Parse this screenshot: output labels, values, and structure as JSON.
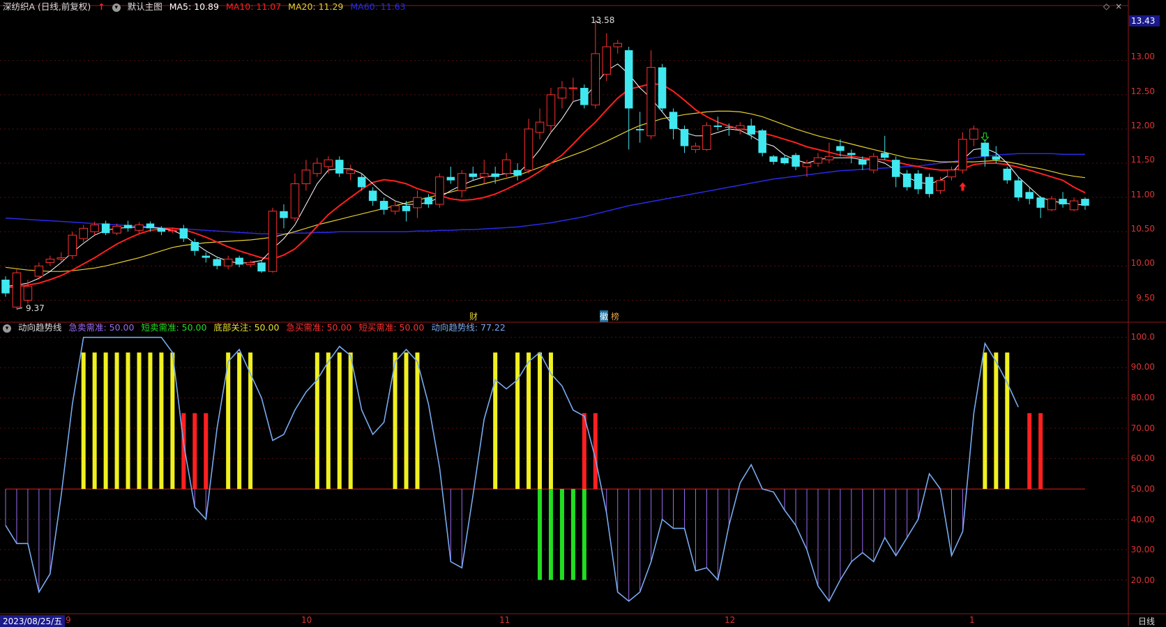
{
  "header_top": {
    "title": "深纺织A (日线,前复权)",
    "main_chart_label": "默认主图",
    "ma5": "MA5: 10.89",
    "ma10": "MA10: 11.07",
    "ma20": "MA20: 11.29",
    "ma60": "MA60: 11.63",
    "colors": {
      "ma5": "#ffffff",
      "ma10": "#ff2020",
      "ma20": "#e8d030",
      "ma60": "#2a2ae8"
    }
  },
  "header_bottom": {
    "indicator": "动向趋势线",
    "items": [
      {
        "text": "急卖需准: 50.00",
        "color": "#9b6cf0"
      },
      {
        "text": "短卖需准: 50.00",
        "color": "#22dd22"
      },
      {
        "text": "底部关注: 50.00",
        "color": "#e8e030"
      },
      {
        "text": "急买需准: 50.00",
        "color": "#ff3030"
      },
      {
        "text": "短买需准: 50.00",
        "color": "#ff3030"
      },
      {
        "text": "动向趋势线: 77.22",
        "color": "#78aaf0"
      }
    ]
  },
  "price_axis": {
    "current_price": "13.43",
    "ticks": [
      "13.00",
      "12.50",
      "12.00",
      "11.50",
      "11.00",
      "10.50",
      "10.00",
      "9.50"
    ]
  },
  "indicator_axis": {
    "ticks": [
      "100.0",
      "90.00",
      "80.00",
      "70.00",
      "60.00",
      "50.00",
      "40.00",
      "30.00",
      "20.00"
    ]
  },
  "annotations": {
    "high": "13.58",
    "low": "9.37",
    "marker_cai": "财",
    "marker_hui": "徽",
    "marker_bang": "榜"
  },
  "date_axis": {
    "cursor_date": "2023/08/25/五",
    "labels": [
      "9",
      "10",
      "11",
      "12",
      "1"
    ],
    "period": "日线"
  },
  "chart_data": {
    "type": "candlestick",
    "candles": [
      {
        "o": 9.8,
        "c": 9.6,
        "h": 9.85,
        "l": 9.55
      },
      {
        "o": 9.4,
        "c": 9.9,
        "h": 9.95,
        "l": 9.37
      },
      {
        "o": 9.5,
        "c": 9.7,
        "h": 9.8,
        "l": 9.45
      },
      {
        "o": 9.85,
        "c": 10.0,
        "h": 10.05,
        "l": 9.8
      },
      {
        "o": 10.05,
        "c": 10.1,
        "h": 10.15,
        "l": 10.0
      },
      {
        "o": 10.1,
        "c": 10.12,
        "h": 10.2,
        "l": 10.05
      },
      {
        "o": 10.15,
        "c": 10.45,
        "h": 10.5,
        "l": 10.1
      },
      {
        "o": 10.4,
        "c": 10.55,
        "h": 10.6,
        "l": 10.35
      },
      {
        "o": 10.5,
        "c": 10.6,
        "h": 10.65,
        "l": 10.45
      },
      {
        "o": 10.62,
        "c": 10.48,
        "h": 10.66,
        "l": 10.45
      },
      {
        "o": 10.48,
        "c": 10.58,
        "h": 10.62,
        "l": 10.45
      },
      {
        "o": 10.6,
        "c": 10.55,
        "h": 10.66,
        "l": 10.5
      },
      {
        "o": 10.52,
        "c": 10.6,
        "h": 10.64,
        "l": 10.48
      },
      {
        "o": 10.62,
        "c": 10.55,
        "h": 10.65,
        "l": 10.5
      },
      {
        "o": 10.55,
        "c": 10.5,
        "h": 10.58,
        "l": 10.45
      },
      {
        "o": 10.52,
        "c": 10.52,
        "h": 10.56,
        "l": 10.48
      },
      {
        "o": 10.55,
        "c": 10.4,
        "h": 10.6,
        "l": 10.35
      },
      {
        "o": 10.35,
        "c": 10.22,
        "h": 10.4,
        "l": 10.15
      },
      {
        "o": 10.15,
        "c": 10.12,
        "h": 10.2,
        "l": 10.05
      },
      {
        "o": 10.1,
        "c": 10.0,
        "h": 10.12,
        "l": 9.95
      },
      {
        "o": 10.0,
        "c": 10.1,
        "h": 10.15,
        "l": 9.95
      },
      {
        "o": 10.12,
        "c": 10.02,
        "h": 10.15,
        "l": 9.98
      },
      {
        "o": 10.02,
        "c": 10.05,
        "h": 10.08,
        "l": 9.98
      },
      {
        "o": 10.05,
        "c": 9.92,
        "h": 10.08,
        "l": 9.9
      },
      {
        "o": 9.92,
        "c": 10.8,
        "h": 10.85,
        "l": 9.9
      },
      {
        "o": 10.8,
        "c": 10.7,
        "h": 10.9,
        "l": 10.55
      },
      {
        "o": 10.7,
        "c": 11.2,
        "h": 11.35,
        "l": 10.65
      },
      {
        "o": 11.2,
        "c": 11.4,
        "h": 11.55,
        "l": 11.1
      },
      {
        "o": 11.35,
        "c": 11.5,
        "h": 11.58,
        "l": 11.3
      },
      {
        "o": 11.45,
        "c": 11.55,
        "h": 11.6,
        "l": 11.35
      },
      {
        "o": 11.55,
        "c": 11.35,
        "h": 11.6,
        "l": 11.3
      },
      {
        "o": 11.35,
        "c": 11.4,
        "h": 11.48,
        "l": 11.25
      },
      {
        "o": 11.3,
        "c": 11.15,
        "h": 11.35,
        "l": 11.1
      },
      {
        "o": 11.1,
        "c": 10.95,
        "h": 11.15,
        "l": 10.88
      },
      {
        "o": 10.95,
        "c": 10.82,
        "h": 11.0,
        "l": 10.75
      },
      {
        "o": 10.8,
        "c": 10.88,
        "h": 10.95,
        "l": 10.75
      },
      {
        "o": 10.88,
        "c": 10.8,
        "h": 10.95,
        "l": 10.65
      },
      {
        "o": 10.85,
        "c": 11.0,
        "h": 11.1,
        "l": 10.7
      },
      {
        "o": 11.0,
        "c": 10.9,
        "h": 11.05,
        "l": 10.85
      },
      {
        "o": 10.9,
        "c": 11.3,
        "h": 11.35,
        "l": 10.85
      },
      {
        "o": 11.3,
        "c": 11.25,
        "h": 11.45,
        "l": 11.2
      },
      {
        "o": 11.1,
        "c": 11.35,
        "h": 11.4,
        "l": 11.0
      },
      {
        "o": 11.35,
        "c": 11.3,
        "h": 11.45,
        "l": 11.25
      },
      {
        "o": 11.3,
        "c": 11.35,
        "h": 11.55,
        "l": 11.2
      },
      {
        "o": 11.35,
        "c": 11.3,
        "h": 11.45,
        "l": 11.2
      },
      {
        "o": 11.35,
        "c": 11.55,
        "h": 11.65,
        "l": 11.3
      },
      {
        "o": 11.4,
        "c": 11.32,
        "h": 11.5,
        "l": 11.25
      },
      {
        "o": 11.4,
        "c": 12.0,
        "h": 12.15,
        "l": 11.35
      },
      {
        "o": 11.95,
        "c": 12.1,
        "h": 12.3,
        "l": 11.85
      },
      {
        "o": 12.05,
        "c": 12.5,
        "h": 12.6,
        "l": 11.95
      },
      {
        "o": 12.45,
        "c": 12.6,
        "h": 12.7,
        "l": 12.3
      },
      {
        "o": 12.6,
        "c": 12.6,
        "h": 12.75,
        "l": 12.4
      },
      {
        "o": 12.6,
        "c": 12.35,
        "h": 12.65,
        "l": 12.3
      },
      {
        "o": 12.35,
        "c": 13.1,
        "h": 13.58,
        "l": 12.3
      },
      {
        "o": 12.8,
        "c": 13.2,
        "h": 13.4,
        "l": 12.7
      },
      {
        "o": 13.2,
        "c": 13.25,
        "h": 13.3,
        "l": 13.1
      },
      {
        "o": 13.15,
        "c": 12.3,
        "h": 13.2,
        "l": 11.7
      },
      {
        "o": 12.0,
        "c": 11.98,
        "h": 12.25,
        "l": 11.8
      },
      {
        "o": 11.9,
        "c": 12.9,
        "h": 13.15,
        "l": 11.85
      },
      {
        "o": 12.9,
        "c": 12.3,
        "h": 12.95,
        "l": 12.25
      },
      {
        "o": 12.25,
        "c": 12.0,
        "h": 12.3,
        "l": 11.85
      },
      {
        "o": 12.0,
        "c": 11.75,
        "h": 12.05,
        "l": 11.65
      },
      {
        "o": 11.7,
        "c": 11.75,
        "h": 11.8,
        "l": 11.65
      },
      {
        "o": 11.7,
        "c": 12.05,
        "h": 12.1,
        "l": 11.68
      },
      {
        "o": 12.05,
        "c": 12.03,
        "h": 12.18,
        "l": 11.98
      },
      {
        "o": 12.03,
        "c": 12.02,
        "h": 12.08,
        "l": 11.9
      },
      {
        "o": 12.0,
        "c": 12.05,
        "h": 12.1,
        "l": 11.92
      },
      {
        "o": 12.05,
        "c": 11.92,
        "h": 12.15,
        "l": 11.85
      },
      {
        "o": 11.98,
        "c": 11.65,
        "h": 12.0,
        "l": 11.6
      },
      {
        "o": 11.6,
        "c": 11.52,
        "h": 11.62,
        "l": 11.48
      },
      {
        "o": 11.58,
        "c": 11.5,
        "h": 11.62,
        "l": 11.48
      },
      {
        "o": 11.62,
        "c": 11.45,
        "h": 11.65,
        "l": 11.4
      },
      {
        "o": 11.45,
        "c": 11.5,
        "h": 11.55,
        "l": 11.3
      },
      {
        "o": 11.5,
        "c": 11.58,
        "h": 11.65,
        "l": 11.45
      },
      {
        "o": 11.55,
        "c": 11.6,
        "h": 11.8,
        "l": 11.5
      },
      {
        "o": 11.75,
        "c": 11.68,
        "h": 11.85,
        "l": 11.6
      },
      {
        "o": 11.65,
        "c": 11.62,
        "h": 11.7,
        "l": 11.5
      },
      {
        "o": 11.55,
        "c": 11.48,
        "h": 11.6,
        "l": 11.4
      },
      {
        "o": 11.4,
        "c": 11.6,
        "h": 11.65,
        "l": 11.35
      },
      {
        "o": 11.65,
        "c": 11.58,
        "h": 11.9,
        "l": 11.55
      },
      {
        "o": 11.55,
        "c": 11.3,
        "h": 11.6,
        "l": 11.15
      },
      {
        "o": 11.35,
        "c": 11.15,
        "h": 11.4,
        "l": 11.1
      },
      {
        "o": 11.35,
        "c": 11.12,
        "h": 11.4,
        "l": 11.05
      },
      {
        "o": 11.3,
        "c": 11.05,
        "h": 11.35,
        "l": 11.0
      },
      {
        "o": 11.1,
        "c": 11.25,
        "h": 11.3,
        "l": 11.05
      },
      {
        "o": 11.3,
        "c": 11.4,
        "h": 11.45,
        "l": 11.25
      },
      {
        "o": 11.4,
        "c": 11.85,
        "h": 11.95,
        "l": 11.35
      },
      {
        "o": 11.85,
        "c": 12.0,
        "h": 12.05,
        "l": 11.75
      },
      {
        "o": 11.8,
        "c": 11.6,
        "h": 11.85,
        "l": 11.45
      },
      {
        "o": 11.6,
        "c": 11.55,
        "h": 11.75,
        "l": 11.5
      },
      {
        "o": 11.42,
        "c": 11.25,
        "h": 11.45,
        "l": 11.2
      },
      {
        "o": 11.25,
        "c": 11.0,
        "h": 11.3,
        "l": 10.95
      },
      {
        "o": 11.08,
        "c": 10.98,
        "h": 11.15,
        "l": 10.9
      },
      {
        "o": 11.0,
        "c": 10.85,
        "h": 11.02,
        "l": 10.7
      },
      {
        "o": 10.82,
        "c": 10.98,
        "h": 11.02,
        "l": 10.8
      },
      {
        "o": 10.98,
        "c": 10.9,
        "h": 11.08,
        "l": 10.85
      },
      {
        "o": 10.82,
        "c": 10.95,
        "h": 11.0,
        "l": 10.8
      },
      {
        "o": 10.98,
        "c": 10.88,
        "h": 11.0,
        "l": 10.82
      }
    ],
    "ma5": [
      9.7,
      9.72,
      9.75,
      9.82,
      9.92,
      10.05,
      10.2,
      10.33,
      10.45,
      10.52,
      10.55,
      10.56,
      10.57,
      10.56,
      10.55,
      10.52,
      10.45,
      10.33,
      10.22,
      10.13,
      10.07,
      10.04,
      10.05,
      10.08,
      10.25,
      10.4,
      10.6,
      10.9,
      11.2,
      11.4,
      11.42,
      11.42,
      11.35,
      11.2,
      11.05,
      10.95,
      10.9,
      10.9,
      10.93,
      11.0,
      11.1,
      11.18,
      11.25,
      11.3,
      11.32,
      11.35,
      11.35,
      11.5,
      11.7,
      11.95,
      12.15,
      12.4,
      12.45,
      12.65,
      12.85,
      12.95,
      12.8,
      12.6,
      12.45,
      12.25,
      12.05,
      11.95,
      11.9,
      11.9,
      11.95,
      12.0,
      11.98,
      11.9,
      11.8,
      11.75,
      11.62,
      11.55,
      11.5,
      11.55,
      11.58,
      11.58,
      11.58,
      11.55,
      11.55,
      11.5,
      11.4,
      11.3,
      11.22,
      11.2,
      11.25,
      11.35,
      11.55,
      11.7,
      11.72,
      11.65,
      11.5,
      11.3,
      11.15,
      11.0,
      10.95,
      10.92,
      10.9,
      10.89
    ],
    "ma10": [
      9.68,
      9.7,
      9.72,
      9.75,
      9.8,
      9.86,
      9.94,
      10.03,
      10.12,
      10.22,
      10.32,
      10.4,
      10.47,
      10.52,
      10.54,
      10.55,
      10.53,
      10.48,
      10.42,
      10.35,
      10.28,
      10.22,
      10.17,
      10.12,
      10.1,
      10.16,
      10.25,
      10.4,
      10.58,
      10.75,
      10.88,
      11.0,
      11.12,
      11.22,
      11.26,
      11.24,
      11.2,
      11.13,
      11.08,
      11.03,
      10.98,
      10.96,
      10.97,
      11.0,
      11.05,
      11.12,
      11.2,
      11.28,
      11.38,
      11.5,
      11.62,
      11.78,
      11.95,
      12.1,
      12.28,
      12.45,
      12.58,
      12.62,
      12.66,
      12.65,
      12.55,
      12.42,
      12.28,
      12.18,
      12.1,
      12.04,
      12.0,
      11.98,
      11.94,
      11.9,
      11.85,
      11.8,
      11.74,
      11.7,
      11.66,
      11.62,
      11.6,
      11.58,
      11.56,
      11.55,
      11.52,
      11.48,
      11.45,
      11.42,
      11.4,
      11.4,
      11.42,
      11.48,
      11.5,
      11.5,
      11.48,
      11.44,
      11.4,
      11.35,
      11.3,
      11.25,
      11.15,
      11.07
    ],
    "ma20": [
      9.98,
      9.96,
      9.94,
      9.93,
      9.92,
      9.92,
      9.93,
      9.95,
      9.97,
      10.0,
      10.04,
      10.08,
      10.12,
      10.17,
      10.22,
      10.27,
      10.3,
      10.32,
      10.34,
      10.35,
      10.36,
      10.37,
      10.38,
      10.4,
      10.42,
      10.46,
      10.5,
      10.55,
      10.6,
      10.64,
      10.68,
      10.72,
      10.76,
      10.8,
      10.84,
      10.88,
      10.92,
      10.96,
      11.0,
      11.04,
      11.08,
      11.12,
      11.16,
      11.2,
      11.24,
      11.28,
      11.32,
      11.38,
      11.44,
      11.5,
      11.56,
      11.62,
      11.68,
      11.75,
      11.82,
      11.9,
      11.98,
      12.05,
      12.1,
      12.15,
      12.18,
      12.21,
      12.23,
      12.25,
      12.26,
      12.26,
      12.25,
      12.22,
      12.18,
      12.12,
      12.06,
      12.0,
      11.95,
      11.9,
      11.86,
      11.82,
      11.78,
      11.74,
      11.7,
      11.66,
      11.62,
      11.58,
      11.56,
      11.54,
      11.52,
      11.52,
      11.52,
      11.52,
      11.53,
      11.54,
      11.52,
      11.49,
      11.45,
      11.42,
      11.38,
      11.34,
      11.31,
      11.29
    ],
    "ma60": [
      10.7,
      10.69,
      10.68,
      10.67,
      10.66,
      10.65,
      10.64,
      10.63,
      10.62,
      10.61,
      10.6,
      10.59,
      10.58,
      10.57,
      10.56,
      10.55,
      10.54,
      10.53,
      10.52,
      10.51,
      10.5,
      10.49,
      10.48,
      10.47,
      10.47,
      10.47,
      10.48,
      10.48,
      10.49,
      10.49,
      10.5,
      10.5,
      10.5,
      10.5,
      10.5,
      10.5,
      10.5,
      10.51,
      10.51,
      10.52,
      10.52,
      10.53,
      10.53,
      10.54,
      10.55,
      10.56,
      10.57,
      10.59,
      10.61,
      10.63,
      10.66,
      10.69,
      10.72,
      10.76,
      10.8,
      10.84,
      10.88,
      10.91,
      10.94,
      10.97,
      11.0,
      11.03,
      11.06,
      11.09,
      11.12,
      11.15,
      11.18,
      11.21,
      11.24,
      11.27,
      11.29,
      11.31,
      11.33,
      11.35,
      11.37,
      11.39,
      11.4,
      11.41,
      11.42,
      11.43,
      11.44,
      11.45,
      11.46,
      11.48,
      11.5,
      11.52,
      11.55,
      11.58,
      11.6,
      11.62,
      11.63,
      11.64,
      11.64,
      11.64,
      11.64,
      11.63,
      11.63,
      11.63
    ],
    "trend": [
      38,
      32,
      32,
      16,
      22,
      48,
      78,
      100,
      100,
      100,
      100,
      100,
      100,
      100,
      100,
      95,
      65,
      44,
      40,
      70,
      92,
      96,
      88,
      80,
      66,
      68,
      76,
      82,
      86,
      92,
      97,
      94,
      76,
      68,
      72,
      92,
      96,
      92,
      78,
      57,
      26,
      24,
      48,
      73,
      86,
      83,
      86,
      92,
      95,
      88,
      84,
      76,
      74,
      60,
      42,
      16,
      13,
      16,
      26,
      40,
      37,
      37,
      23,
      24,
      20,
      38,
      52,
      58,
      50,
      49,
      43,
      38,
      30,
      18,
      13,
      20,
      26,
      29,
      26,
      34,
      28,
      34,
      40,
      55,
      50,
      28,
      36,
      75,
      98,
      92,
      85,
      77
    ],
    "indicator_ylim": [
      10,
      102
    ],
    "price_ylim": [
      9.25,
      13.7
    ]
  }
}
